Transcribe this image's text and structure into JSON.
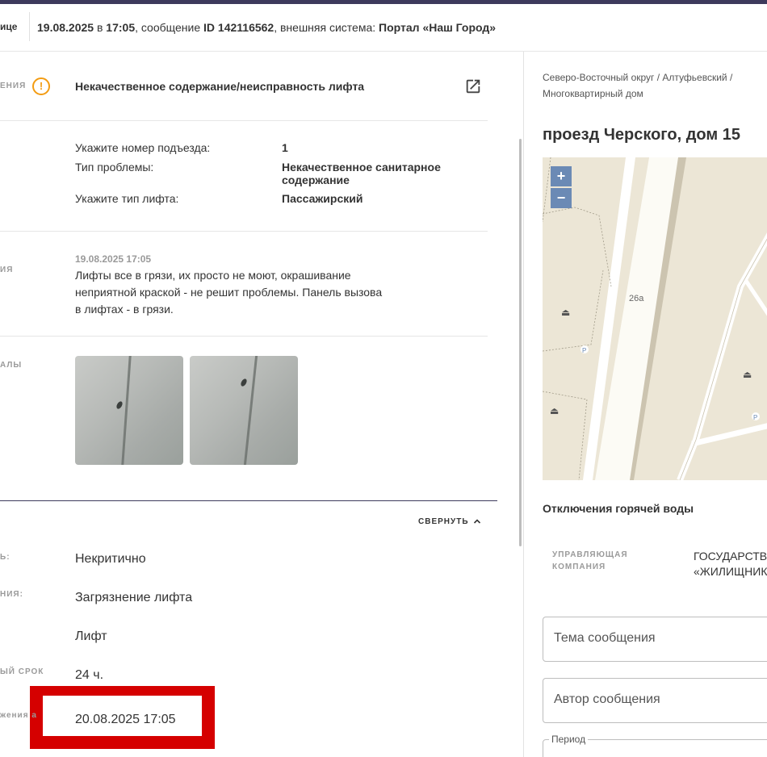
{
  "header": {
    "left_fragment": "ице",
    "date": "19.08.2025",
    "in_word": " в ",
    "time": "17:05",
    "msg_prefix": ", сообщение ",
    "msg_id": "ID 142116562",
    "sys_prefix": ", внешняя система: ",
    "system": "Портал «Наш Город»"
  },
  "left": {
    "frag_category": "ения",
    "problem_title": "Некачественное содержание/неисправность лифта",
    "fields": [
      {
        "label": "Укажите номер подъезда:",
        "value": "1"
      },
      {
        "label": "Тип проблемы:",
        "value": "Некачественное санитарное содержание"
      },
      {
        "label": "Укажите тип лифта:",
        "value": "Пассажирский"
      }
    ],
    "frag_message": "ия",
    "message_date": "19.08.2025 17:05",
    "message_text": "Лифты все в грязи, их просто не моют, окрашивание неприятной краской - не решит проблемы. Панель вызова в лифтах - в грязи.",
    "frag_materials": "алы",
    "collapse_label": "СВЕРНУТЬ",
    "details": [
      {
        "frag": "ь:",
        "value": "Некритично"
      },
      {
        "frag": "ния:",
        "value": "Загрязнение лифта"
      },
      {
        "frag": "",
        "value": "Лифт"
      },
      {
        "frag": "ый срок",
        "value": "24 ч."
      }
    ],
    "highlight": {
      "frag": "жения а",
      "value": "20.08.2025 17:05"
    }
  },
  "right": {
    "breadcrumb_1": "Северо-Восточный округ / Алтуфьевский /",
    "breadcrumb_2": "Многоквартирный дом",
    "address": "проезд Черского, дом 15",
    "map": {
      "label_26a": "26а",
      "zoom_in": "+",
      "zoom_out": "−"
    },
    "hot_water_title": "Отключения горячей воды",
    "mc_label_1": "УПРАВЛЯЮЩАЯ",
    "mc_label_2": "КОМПАНИЯ",
    "mc_value_1": "ГОСУДАРСТВЕ",
    "mc_value_2": "«ЖИЛИЩНИК",
    "topic_placeholder": "Тема сообщения",
    "author_placeholder": "Автор сообщения",
    "period_label": "Период"
  },
  "colors": {
    "accent_dark": "#3d3a5c",
    "warning": "#f39c12",
    "highlight_red": "#d50000"
  }
}
